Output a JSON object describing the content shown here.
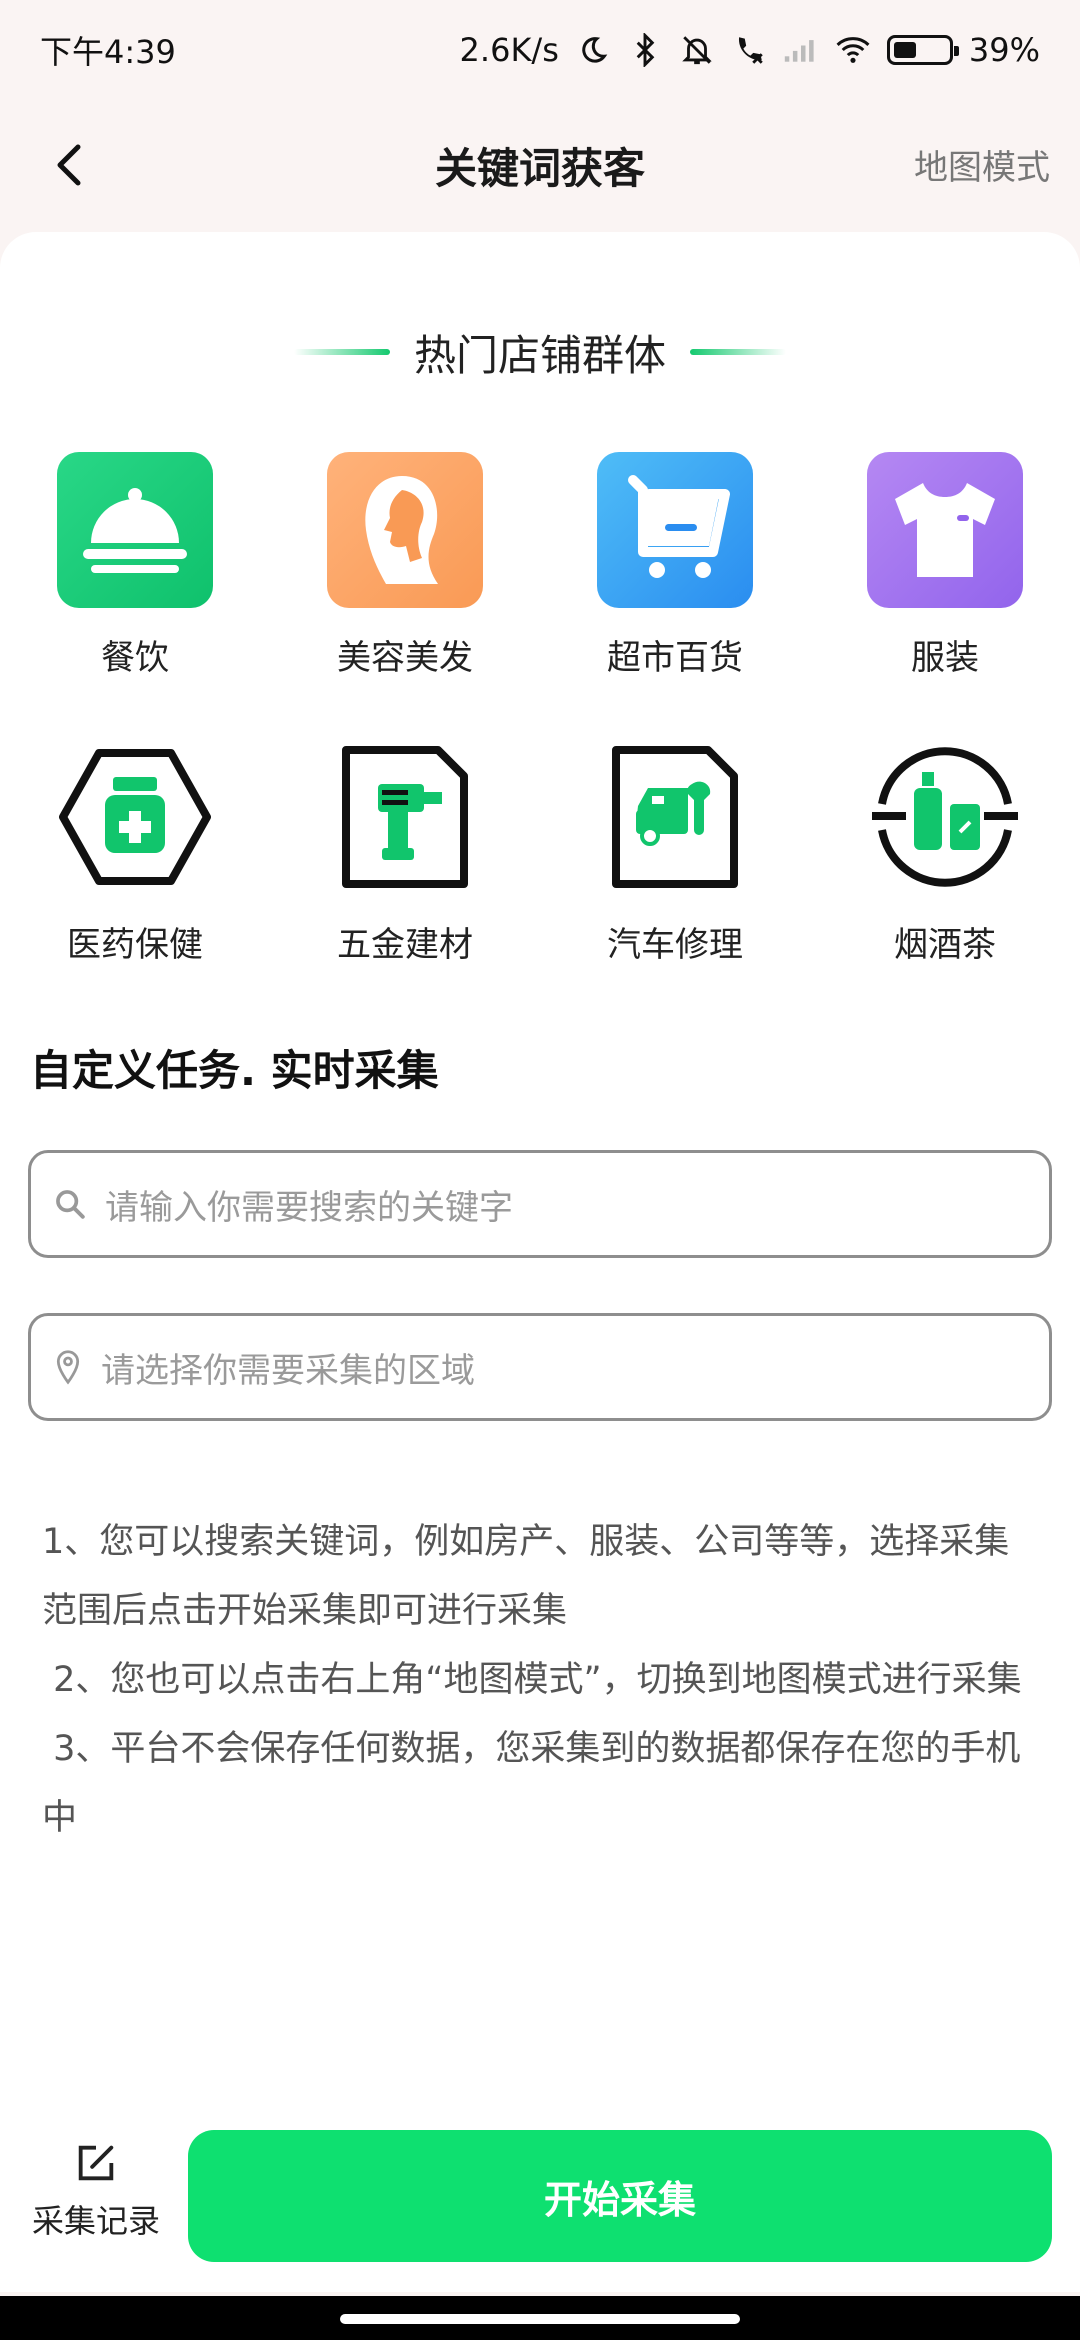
{
  "status_bar": {
    "time": "下午4:39",
    "network_speed": "2.6K/s",
    "battery": "39%",
    "icons": [
      "moon-icon",
      "bluetooth-icon",
      "mute-bell-icon",
      "call-icon",
      "signal-icon",
      "wifi-icon",
      "battery-icon"
    ]
  },
  "header": {
    "title": "关键词获客",
    "right_action": "地图模式",
    "back_icon": "chevron-left-icon"
  },
  "hot_section": {
    "title": "热门店铺群体",
    "accent_color": "#14c96f",
    "categories": [
      {
        "label": "餐饮",
        "icon": "food-cloche-icon"
      },
      {
        "label": "美容美发",
        "icon": "woman-profile-icon"
      },
      {
        "label": "超市百货",
        "icon": "shopping-cart-icon"
      },
      {
        "label": "服装",
        "icon": "tshirt-icon"
      },
      {
        "label": "医药保健",
        "icon": "medicine-bottle-icon"
      },
      {
        "label": "五金建材",
        "icon": "drill-icon"
      },
      {
        "label": "汽车修理",
        "icon": "car-repair-icon"
      },
      {
        "label": "烟酒茶",
        "icon": "bottles-icon"
      }
    ]
  },
  "custom_task": {
    "title": "自定义任务. 实时采集",
    "search_placeholder": "请输入你需要搜索的关键字",
    "area_placeholder": "请选择你需要采集的区域"
  },
  "notes": [
    "1、您可以搜索关键词，例如房产、服装、公司等等，选择采集范围后点击开始采集即可进行采集",
    " 2、您也可以点击右上角“地图模式”，切换到地图模式进行采集",
    " 3、平台不会保存任何数据，您采集到的数据都保存在您的手机中"
  ],
  "bottom": {
    "records_label": "采集记录",
    "start_label": "开始采集",
    "start_color": "#0ee070"
  }
}
